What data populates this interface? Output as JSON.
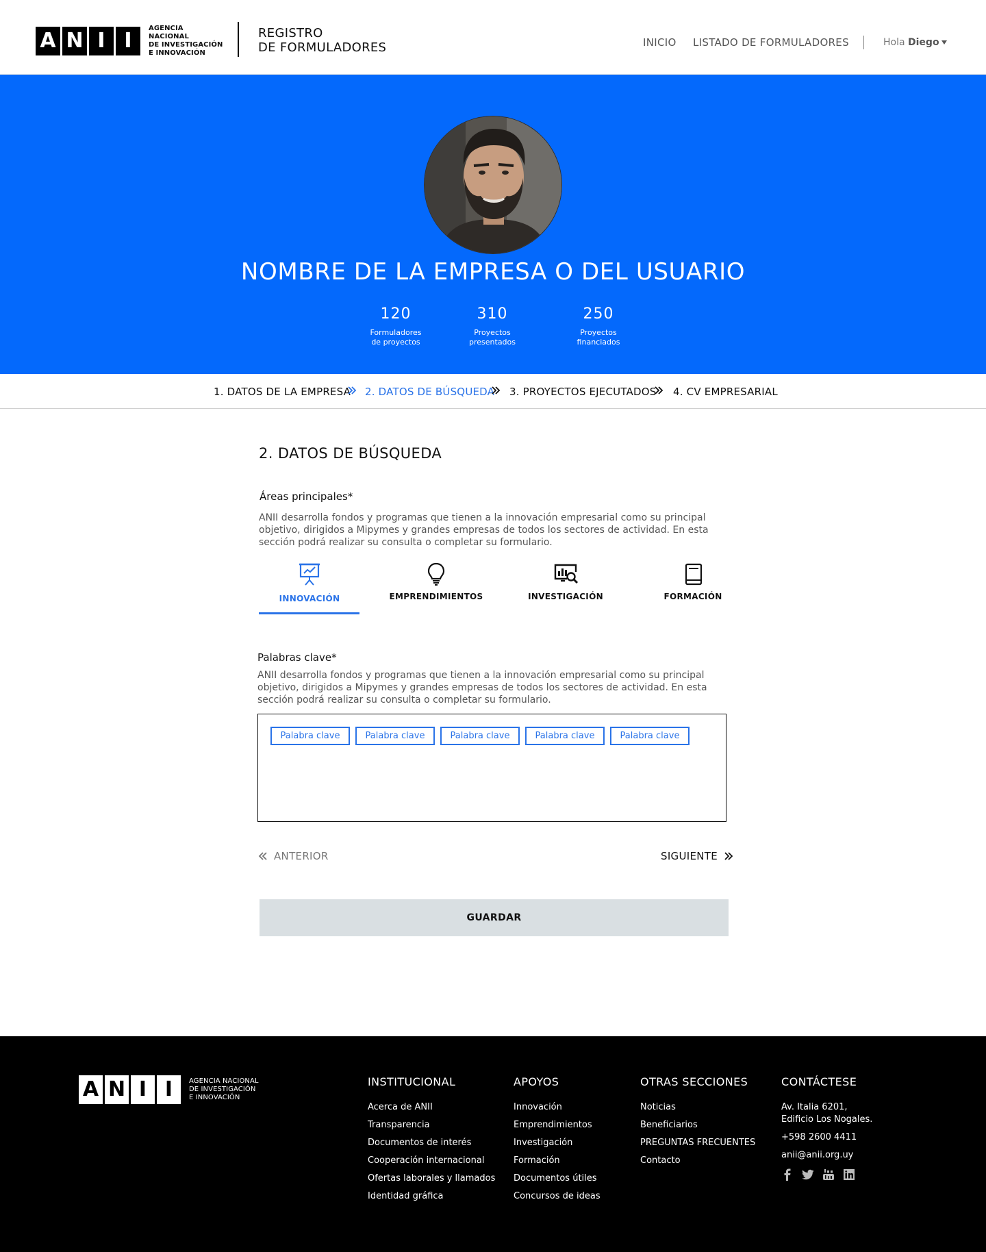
{
  "header": {
    "logo_letters": [
      "A",
      "N",
      "I",
      "I"
    ],
    "logo_lines": [
      "AGENCIA NACIONAL",
      "DE INVESTIGACIÓN",
      "E INNOVACIÓN"
    ],
    "site_title_line1": "REGISTRO",
    "site_title_line2": "DE FORMULADORES",
    "nav": {
      "inicio": "INICIO",
      "listado": "LISTADO DE FORMULADORES"
    },
    "greeting": "Hola",
    "user_name": "Diego"
  },
  "hero": {
    "name": "NOMBRE DE LA EMPRESA O DEL USUARIO",
    "stats": [
      {
        "value": "120",
        "line1": "Formuladores",
        "line2": "de proyectos"
      },
      {
        "value": "310",
        "line1": "Proyectos",
        "line2": "presentados"
      },
      {
        "value": "250",
        "line1": "Proyectos",
        "line2": "financiados"
      }
    ]
  },
  "steps": [
    {
      "label": "1. DATOS DE LA EMPRESA",
      "active": false
    },
    {
      "label": "2. DATOS DE BÚSQUEDA",
      "active": true
    },
    {
      "label": "3. PROYECTOS EJECUTADOS",
      "active": false
    },
    {
      "label": "4. CV EMPRESARIAL",
      "active": false
    }
  ],
  "form": {
    "section_title": "2. DATOS DE BÚSQUEDA",
    "areas_label": "Áreas principales*",
    "areas_desc": "ANII desarrolla fondos y programas que tienen a la innovación empresarial como su principal objetivo, dirigidos a Mipymes y grandes empresas de todos los sectores de actividad. En esta sección podrá realizar su consulta o completar su formulario.",
    "areas": [
      {
        "label": "INNOVACIÓN",
        "icon": "presentation-chart-icon",
        "active": true
      },
      {
        "label": "EMPRENDIMIENTOS",
        "icon": "lightbulb-icon",
        "active": false
      },
      {
        "label": "INVESTIGACIÓN",
        "icon": "monitor-search-icon",
        "active": false
      },
      {
        "label": "FORMACIÓN",
        "icon": "book-icon",
        "active": false
      }
    ],
    "keywords_label": "Palabras clave*",
    "keywords_desc": "ANII desarrolla fondos y programas que tienen a la innovación empresarial como su principal objetivo, dirigidos a Mipymes y grandes empresas de todos los sectores de actividad. En esta sección podrá realizar su consulta o completar su formulario.",
    "keywords": [
      "Palabra clave",
      "Palabra clave",
      "Palabra clave",
      "Palabra clave",
      "Palabra clave"
    ],
    "prev_label": "ANTERIOR",
    "next_label": "SIGUIENTE",
    "save_label": "GUARDAR"
  },
  "footer": {
    "institucional": {
      "title": "INSTITUCIONAL",
      "links": [
        "Acerca de ANII",
        "Transparencia",
        "Documentos de interés",
        "Cooperación internacional",
        "Ofertas laborales y llamados",
        "Identidad gráfica"
      ]
    },
    "apoyos": {
      "title": "APOYOS",
      "links": [
        "Innovación",
        "Emprendimientos",
        "Investigación",
        "Formación",
        "Documentos útiles",
        "Concursos de ideas"
      ]
    },
    "otras": {
      "title": "OTRAS SECCIONES",
      "links": [
        "Noticias",
        "Beneficiarios",
        "PREGUNTAS FRECUENTES",
        "Contacto"
      ]
    },
    "contacto": {
      "title": "CONTÁCTESE",
      "address_line1": "Av. Italia 6201,",
      "address_line2": "Edificio Los Nogales.",
      "phone": "+598 2600 4411",
      "email": "anii@anii.org.uy",
      "social": [
        "facebook-icon",
        "twitter-icon",
        "youtube-icon",
        "linkedin-icon"
      ]
    }
  },
  "colors": {
    "brand_blue": "#0469fc",
    "accent_blue": "#2a73e8",
    "save_button_bg": "#d9dfe2",
    "footer_bg": "#000000"
  }
}
